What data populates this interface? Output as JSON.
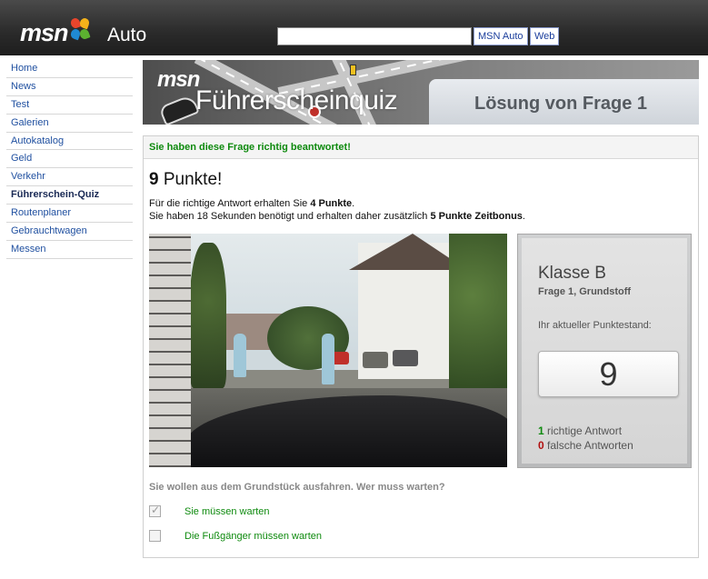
{
  "header": {
    "logo_text": "msn",
    "section": "Auto",
    "search_value": "",
    "btn_msn_auto": "MSN Auto",
    "btn_web": "Web"
  },
  "sidebar": {
    "items": [
      {
        "label": "Home"
      },
      {
        "label": "News"
      },
      {
        "label": "Test"
      },
      {
        "label": "Galerien"
      },
      {
        "label": "Autokatalog"
      },
      {
        "label": "Geld"
      },
      {
        "label": "Verkehr"
      },
      {
        "label": "Führerschein-Quiz",
        "active": true
      },
      {
        "label": "Routenplaner"
      },
      {
        "label": "Gebrauchtwagen"
      },
      {
        "label": "Messen"
      }
    ]
  },
  "banner": {
    "logo": "msn",
    "title": "Führerscheinquiz",
    "subtitle": "Lösung von Frage 1"
  },
  "result": {
    "status": "Sie haben diese Frage richtig beantwortet!",
    "points": "9",
    "points_suffix": " Punkte!",
    "line1_prefix": "Für die richtige Antwort erhalten Sie ",
    "line1_bold": "4 Punkte",
    "line1_suffix": ".",
    "line2_prefix": "Sie haben 18 Sekunden benötigt und erhalten daher zusätzlich ",
    "line2_bold": "5 Punkte Zeitbonus",
    "line2_suffix": "."
  },
  "score_panel": {
    "klasse": "Klasse B",
    "frage": "Frage 1, Grundstoff",
    "stand_label": "Ihr aktueller Punktestand:",
    "score": "9",
    "correct_count": "1",
    "correct_label": " richtige Antwort",
    "wrong_count": "0",
    "wrong_label": " falsche Antworten"
  },
  "question": {
    "text": "Sie wollen aus dem Grundstück ausfahren. Wer muss warten?",
    "options": [
      {
        "label": "Sie müssen warten",
        "checked": true
      },
      {
        "label": "Die Fußgänger müssen warten",
        "checked": false
      }
    ]
  },
  "colors": {
    "accent_green": "#0e8a0e",
    "link_blue": "#2050a0",
    "wrong_red": "#b01010",
    "header_dark": "#2a2a2a"
  }
}
